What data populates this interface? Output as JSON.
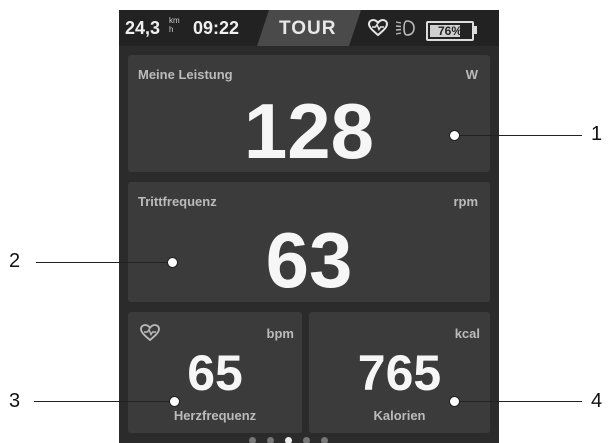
{
  "status": {
    "speed": "24,3",
    "speed_unit_top": "km",
    "speed_unit_bottom": "h",
    "time": "09:22",
    "mode": "TOUR",
    "battery_percent": "76%",
    "battery_level": 0.76
  },
  "tiles": {
    "power": {
      "label": "Meine Leistung",
      "unit": "W",
      "value": "128"
    },
    "cadence": {
      "label": "Trittfrequenz",
      "unit": "rpm",
      "value": "63"
    },
    "heart_rate": {
      "label": "Herzfrequenz",
      "unit": "bpm",
      "value": "65"
    },
    "calories": {
      "label": "Kalorien",
      "unit": "kcal",
      "value": "765"
    }
  },
  "callouts": [
    "1",
    "2",
    "3",
    "4"
  ]
}
